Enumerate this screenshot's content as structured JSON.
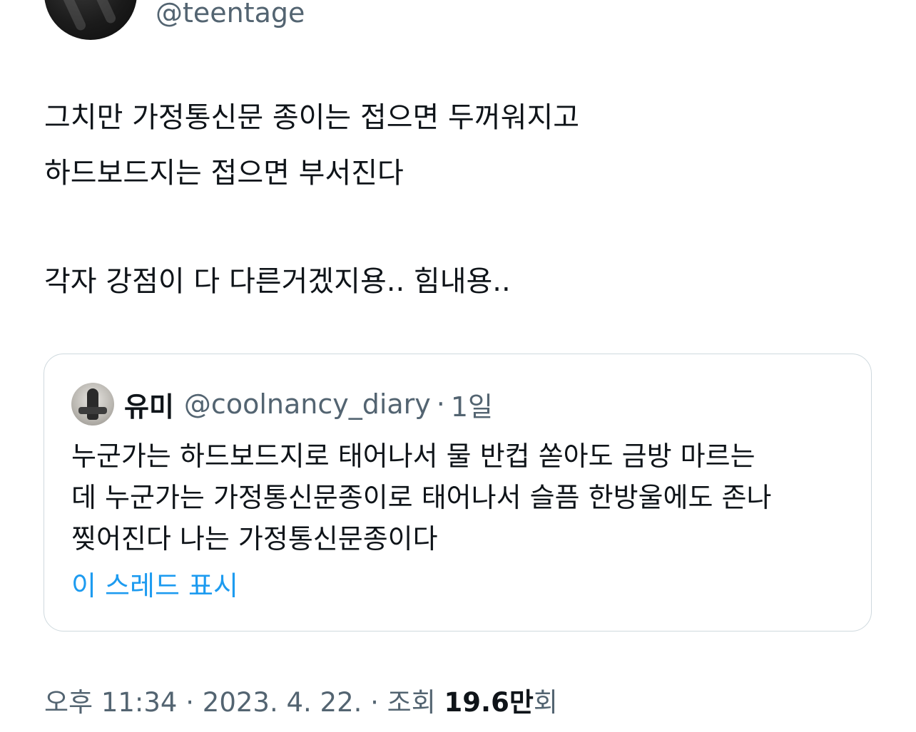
{
  "author": {
    "handle": "@teentage"
  },
  "tweet": {
    "lines": [
      "그치만 가정통신문 종이는 접으면 두꺼워지고",
      "하드보드지는 접으면 부서진다",
      "",
      "각자 강점이 다 다른거겠지용.. 힘내용.."
    ]
  },
  "quoted_tweet": {
    "name": "유미",
    "handle": "@coolnancy_diary",
    "separator": "·",
    "time": "1일",
    "lines": [
      "누군가는 하드보드지로 태어나서 물 반컵 쏟아도 금방 마르는",
      "데 누군가는 가정통신문종이로 태어나서 슬픔 한방울에도 존나",
      "찢어진다 나는 가정통신문종이다"
    ],
    "show_thread_label": "이 스레드 표시"
  },
  "meta": {
    "time": "오후 11:34",
    "sep1": "·",
    "date": "2023. 4. 22.",
    "sep2": "·",
    "views_label_prefix": "조회",
    "views_number": "19.6만",
    "views_label_suffix": "회"
  },
  "colors": {
    "text": "#0f1419",
    "secondary": "#536471",
    "link": "#1d9bf0",
    "border": "#cfd9de"
  }
}
